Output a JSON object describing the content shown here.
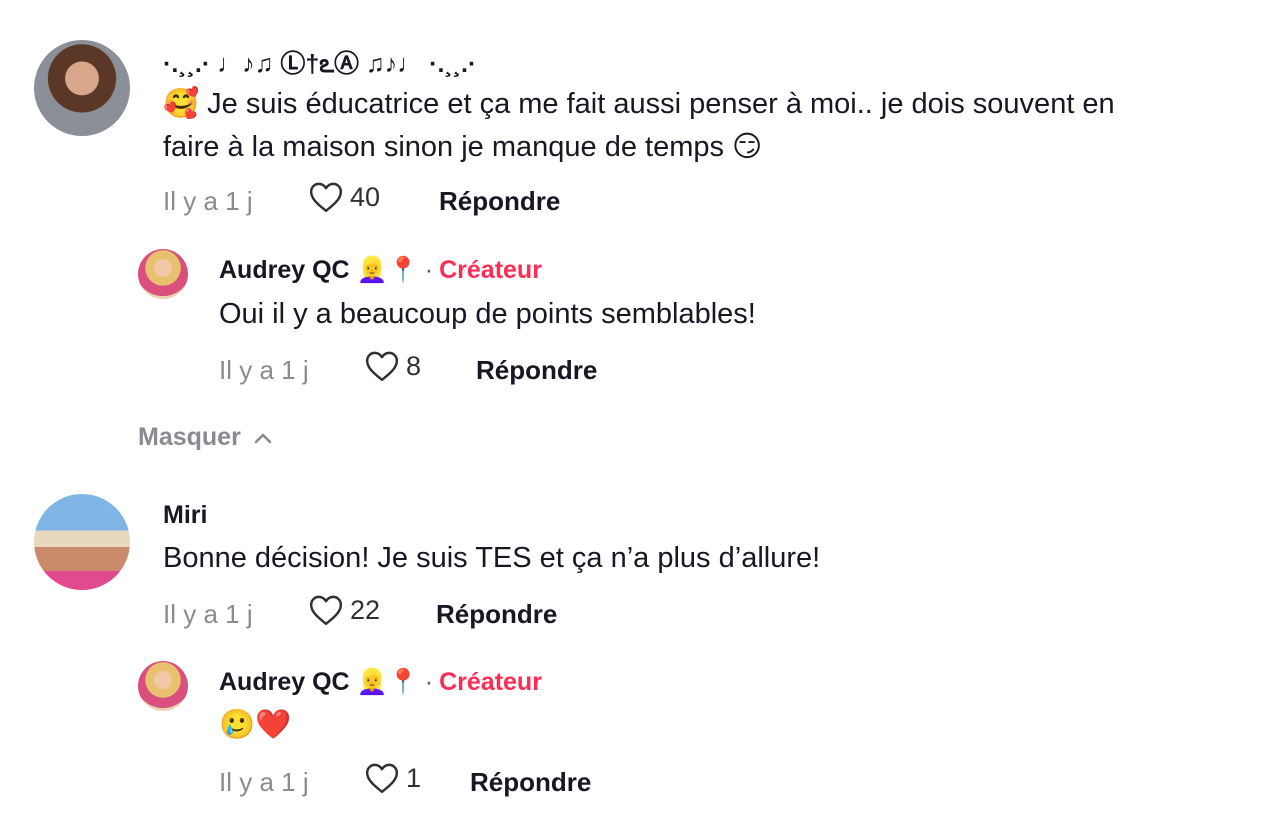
{
  "comments": [
    {
      "username": "·.¸¸.· ♩♪♫ Ⓛ†ఽⒶ ♫♪♩ ·.¸¸.·",
      "text_line1": "🥰 Je suis éducatrice et ça me fait aussi penser à moi.. je dois souvent en",
      "text_line2": "faire à la maison sinon je manque de temps 😏",
      "time": "Il y a 1 j",
      "likes": "40",
      "reply_label": "Répondre"
    },
    {
      "username": "Audrey QC 👱‍♀️📍",
      "creator_label": "Créateur",
      "text": "Oui il y a beaucoup de points semblables!",
      "time": "Il y a 1 j",
      "likes": "8",
      "reply_label": "Répondre"
    },
    {
      "username": "Miri",
      "text": "Bonne décision! Je suis TES et ça n’a plus d’allure!",
      "time": "Il y a 1 j",
      "likes": "22",
      "reply_label": "Répondre"
    },
    {
      "username": "Audrey QC 👱‍♀️📍",
      "creator_label": "Créateur",
      "text": "🥲❤️",
      "time": "Il y a 1 j",
      "likes": "1",
      "reply_label": "Répondre"
    }
  ],
  "hide_replies_label": "Masquer",
  "icons": {
    "heart": "heart-outline-icon",
    "chevron": "chevron-up-icon"
  },
  "colors": {
    "creator": "#fe2c55",
    "meta": "#8a8b91",
    "text": "#161823"
  }
}
